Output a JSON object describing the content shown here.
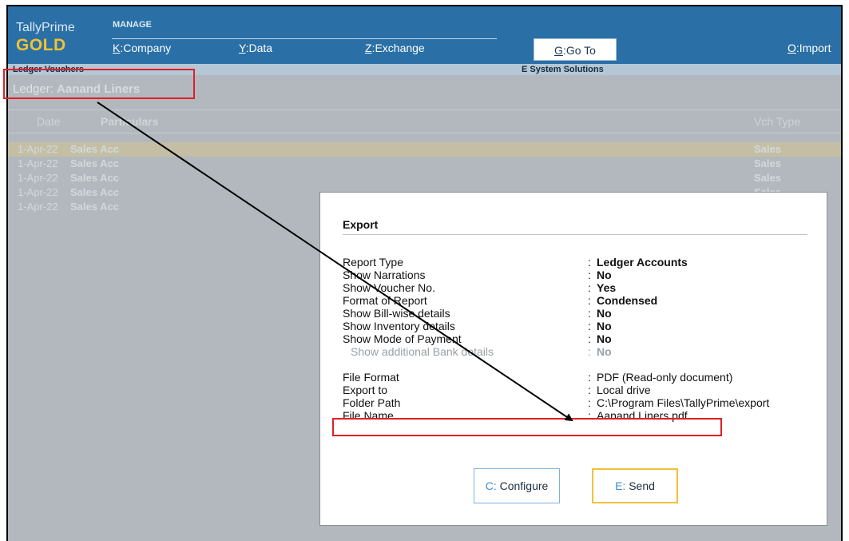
{
  "app": {
    "name": "TallyPrime",
    "edition": "GOLD",
    "manage_label": "MANAGE"
  },
  "menu": {
    "company": {
      "key": "K",
      "label": "Company"
    },
    "data": {
      "key": "Y",
      "label": "Data"
    },
    "exchange": {
      "key": "Z",
      "label": "Exchange"
    },
    "goto": {
      "key": "G",
      "label": "Go To"
    },
    "import": {
      "key": "O",
      "label": "Import"
    }
  },
  "header": {
    "report_title": "Ledger Vouchers",
    "company": "E System Solutions"
  },
  "ledger": {
    "label": "Ledger:",
    "name": "Aanand Liners"
  },
  "columns": {
    "date": "Date",
    "particulars": "Particulars",
    "vch_type": "Vch Type"
  },
  "rows": [
    {
      "date": "1-Apr-22",
      "particulars": "Sales Acc",
      "vch_type": "Sales"
    },
    {
      "date": "1-Apr-22",
      "particulars": "Sales Acc",
      "vch_type": "Sales"
    },
    {
      "date": "1-Apr-22",
      "particulars": "Sales Acc",
      "vch_type": "Sales"
    },
    {
      "date": "1-Apr-22",
      "particulars": "Sales Acc",
      "vch_type": "Sales"
    },
    {
      "date": "1-Apr-22",
      "particulars": "Sales Acc",
      "vch_type": ""
    }
  ],
  "export": {
    "title": "Export",
    "fields": [
      {
        "label": "Report Type",
        "value": "Ledger Accounts"
      },
      {
        "label": "Show Narrations",
        "value": "No"
      },
      {
        "label": "Show Voucher No.",
        "value": "Yes"
      },
      {
        "label": "Format of Report",
        "value": "Condensed"
      },
      {
        "label": "Show Bill-wise details",
        "value": "No"
      },
      {
        "label": "Show Inventory details",
        "value": "No"
      },
      {
        "label": "Show Mode of Payment",
        "value": "No"
      },
      {
        "label": "Show additional Bank details",
        "value": "No"
      },
      {
        "label": "File Format",
        "value": "PDF (Read-only document)"
      },
      {
        "label": "Export to",
        "value": "Local drive"
      },
      {
        "label": "Folder Path",
        "value": "C:\\Program Files\\TallyPrime\\export"
      },
      {
        "label": "File Name",
        "value": "Aanand Liners.pdf"
      }
    ],
    "colon": ":",
    "configure": {
      "key": "C",
      "label": "Configure"
    },
    "send": {
      "key": "E",
      "label": "Send"
    }
  }
}
